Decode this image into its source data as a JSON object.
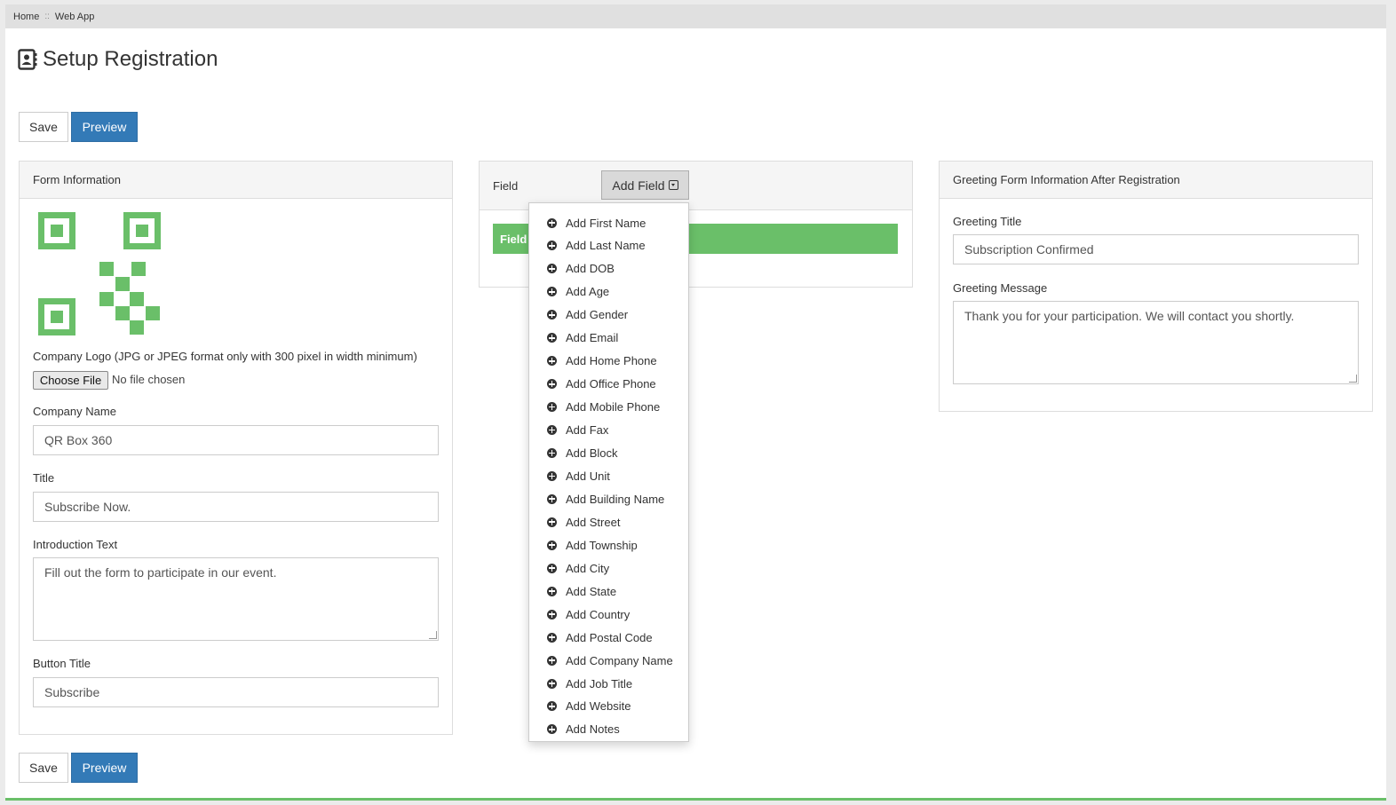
{
  "breadcrumb": {
    "home": "Home",
    "separator": "::",
    "current": "Web App"
  },
  "page_title": "Setup Registration",
  "icons": {
    "title": "contact-book-icon",
    "menu_item": "plus-circle-icon",
    "dropdown": "caret-square-down-icon"
  },
  "actions": {
    "save": "Save",
    "preview": "Preview"
  },
  "colors": {
    "accent_green": "#6abf69",
    "primary_blue": "#337ab7"
  },
  "form_info": {
    "heading": "Form Information",
    "logo_label": "Company Logo (JPG or JPEG format only with 300 pixel in width minimum)",
    "choose_file": "Choose File",
    "no_file": "No file chosen",
    "company_name_label": "Company Name",
    "company_name_value": "QR Box 360",
    "title_label": "Title",
    "title_value": "Subscribe Now.",
    "intro_label": "Introduction Text",
    "intro_value": "Fill out the form to participate in our event.",
    "button_title_label": "Button Title",
    "button_title_value": "Subscribe"
  },
  "field_panel": {
    "heading": "Field",
    "add_field": "Add Field",
    "field_row_label": "Field",
    "menu_items": [
      "Add First Name",
      "Add Last Name",
      "Add DOB",
      "Add Age",
      "Add Gender",
      "Add Email",
      "Add Home Phone",
      "Add Office Phone",
      "Add Mobile Phone",
      "Add Fax",
      "Add Block",
      "Add Unit",
      "Add Building Name",
      "Add Street",
      "Add Township",
      "Add City",
      "Add State",
      "Add Country",
      "Add Postal Code",
      "Add Company Name",
      "Add Job Title",
      "Add Website",
      "Add Notes"
    ]
  },
  "greeting": {
    "heading": "Greeting Form Information After Registration",
    "title_label": "Greeting Title",
    "title_value": "Subscription Confirmed",
    "message_label": "Greeting Message",
    "message_value": "Thank you for your participation. We will contact you shortly."
  }
}
